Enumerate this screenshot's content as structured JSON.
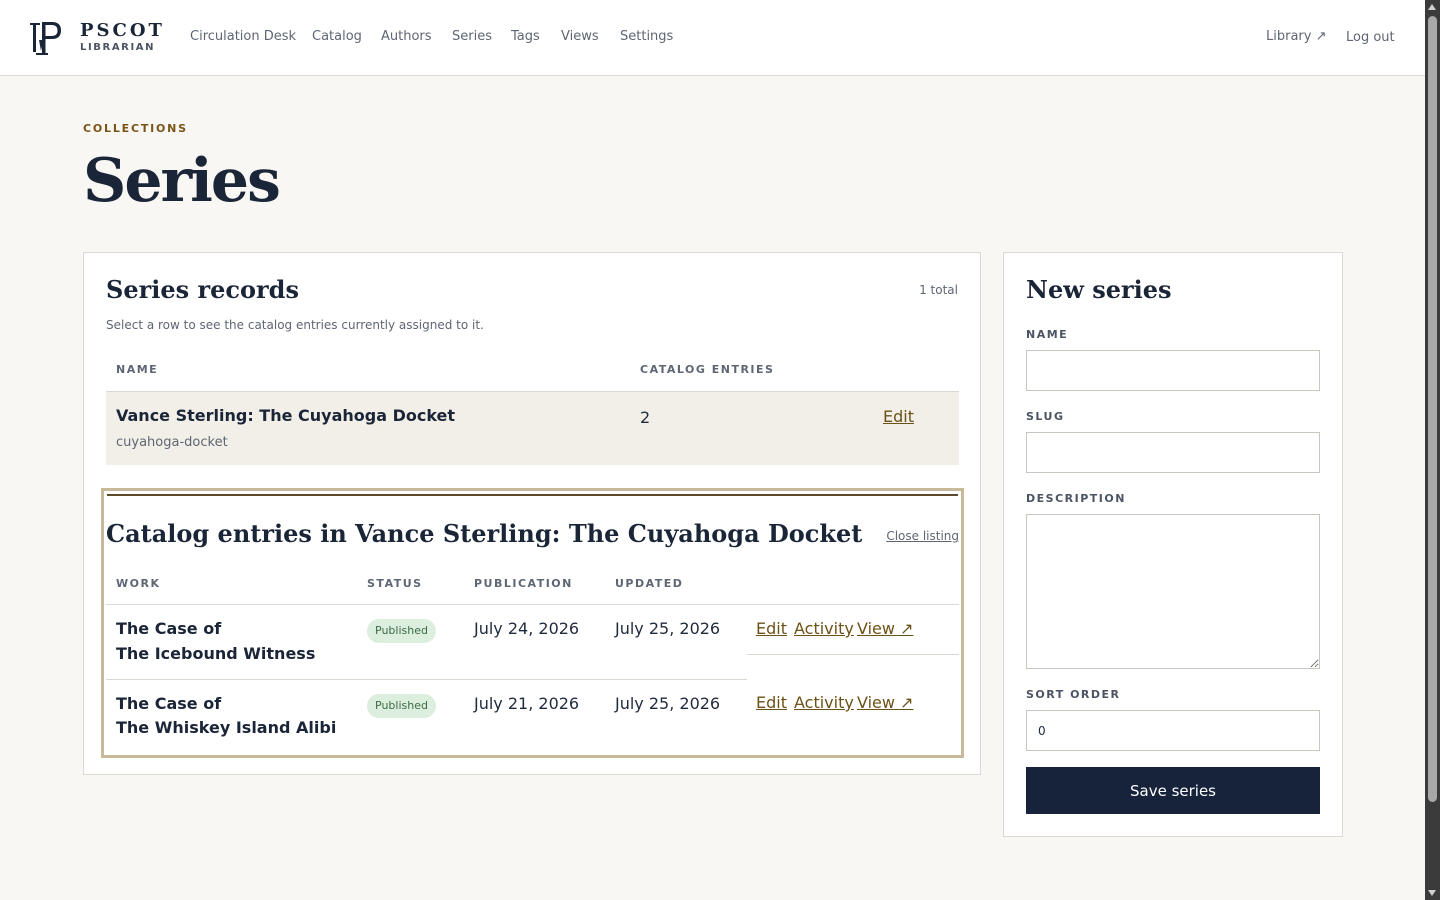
{
  "brand": {
    "name": "PSCOT",
    "subtitle": "LIBRARIAN"
  },
  "nav": {
    "links": [
      "Circulation Desk",
      "Catalog",
      "Authors",
      "Series",
      "Tags",
      "Views",
      "Settings"
    ],
    "library": "Library ↗",
    "logout": "Log out"
  },
  "page": {
    "eyebrow": "COLLECTIONS",
    "title": "Series"
  },
  "records": {
    "title": "Series records",
    "total": "1 total",
    "description": "Select a row to see the catalog entries currently assigned to it.",
    "columns": {
      "name": "NAME",
      "entries": "CATALOG ENTRIES"
    },
    "rows": [
      {
        "name": "Vance Sterling: The Cuyahoga Docket",
        "slug": "cuyahoga-docket",
        "entries": "2",
        "edit": "Edit"
      }
    ]
  },
  "listing": {
    "title": "Catalog entries in Vance Sterling: The Cuyahoga Docket",
    "close": "Close listing",
    "columns": {
      "work": "WORK",
      "status": "STATUS",
      "publication": "PUBLICATION",
      "updated": "UPDATED"
    },
    "entries": [
      {
        "line1": "The Case of",
        "line2": "The Icebound Witness",
        "status": "Published",
        "publication": "July 24, 2026",
        "updated": "July 25, 2026",
        "edit": "Edit",
        "activity": "Activity",
        "view": "View ↗"
      },
      {
        "line1": "The Case of",
        "line2": "The Whiskey Island Alibi",
        "status": "Published",
        "publication": "July 21, 2026",
        "updated": "July 25, 2026",
        "edit": "Edit",
        "activity": "Activity",
        "view": "View ↗"
      }
    ]
  },
  "form": {
    "title": "New series",
    "name_label": "NAME",
    "name_value": "",
    "slug_label": "SLUG",
    "slug_value": "",
    "description_label": "DESCRIPTION",
    "description_value": "",
    "sort_label": "SORT ORDER",
    "sort_value": "0",
    "save": "Save series"
  },
  "colors": {
    "accent": "#6b5216",
    "primary": "#16233b",
    "eyebrow": "#7a5416",
    "badge_bg": "#dceedd",
    "badge_text": "#3d6b47"
  },
  "icons": {
    "logo": "pscot-logo-icon"
  }
}
